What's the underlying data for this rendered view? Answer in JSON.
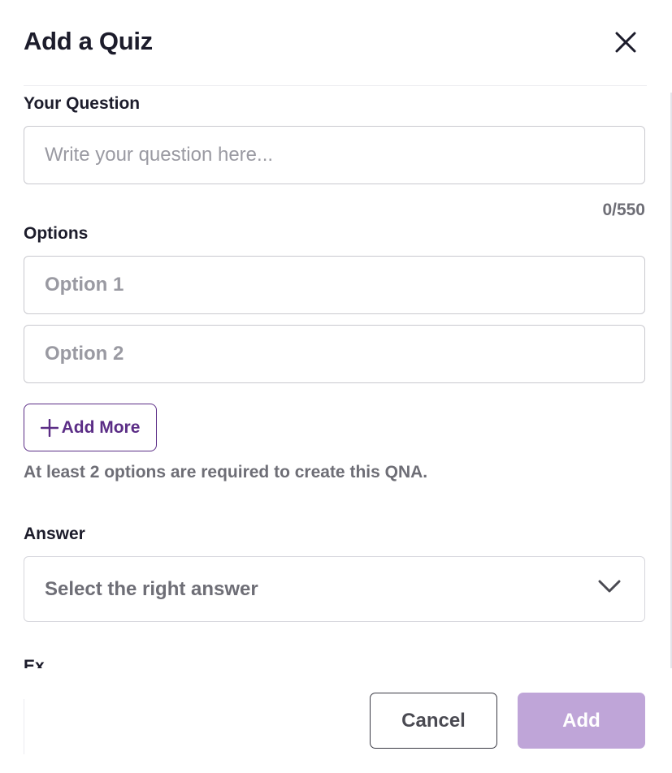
{
  "dialog": {
    "title": "Add a Quiz"
  },
  "question": {
    "label": "Your Question",
    "placeholder": "Write your question here...",
    "value": "",
    "counter": "0/550"
  },
  "options": {
    "label": "Options",
    "items": [
      {
        "placeholder": "Option 1",
        "value": ""
      },
      {
        "placeholder": "Option 2",
        "value": ""
      }
    ],
    "add_more_label": "Add More",
    "hint": "At least 2 options are required to create this QNA."
  },
  "answer": {
    "label": "Answer",
    "selected_text": "Select the right answer"
  },
  "next_section_label_partial": "Ex",
  "footer": {
    "cancel_label": "Cancel",
    "add_label": "Add"
  },
  "colors": {
    "accent": "#5b2d86",
    "add_button_disabled": "#bfa5d8",
    "muted_text": "#6e6e76",
    "placeholder": "#9a9aa2"
  },
  "icons": {
    "close": "close-icon",
    "add": "plus-icon",
    "dropdown": "chevron-down-icon"
  }
}
